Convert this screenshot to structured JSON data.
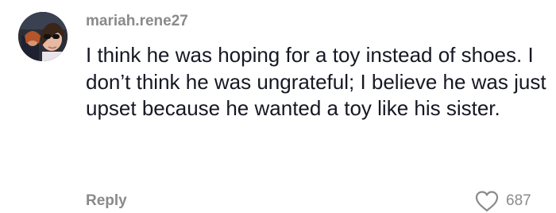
{
  "comment": {
    "username": "mariah.rene27",
    "avatar_icon": "profile-photo",
    "text": "I think he was hoping for a toy instead of shoes. I don’t think he was ungrateful; I believe he was just upset because he wanted a toy like his sister.",
    "reply_label": "Reply",
    "like_icon": "heart-outline-icon",
    "like_count": "687"
  },
  "colors": {
    "username": "#8a8a8a",
    "text": "#161823",
    "meta": "#8a8a8a",
    "background": "#ffffff"
  }
}
